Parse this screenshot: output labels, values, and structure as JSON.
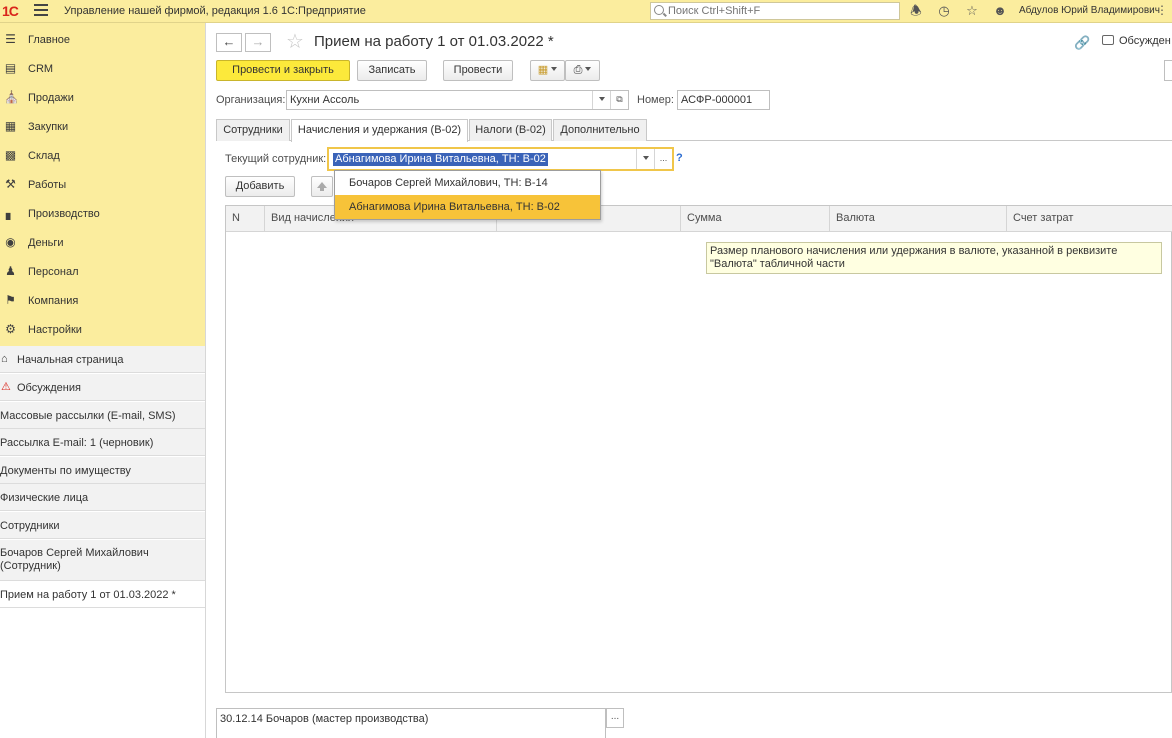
{
  "topbar": {
    "logo": "1С",
    "app_title": "Управление нашей фирмой, редакция 1.6 1С:Предприятие",
    "search_placeholder": "Поиск Ctrl+Shift+F",
    "user": "Абдулов Юрий Владимирович",
    "accent": "#fbed9e"
  },
  "sidebar": {
    "sections": [
      {
        "label": "Главное",
        "icon": "menu-lines-icon"
      },
      {
        "label": "CRM",
        "icon": "crm-card-icon"
      },
      {
        "label": "Продажи",
        "icon": "shop-icon"
      },
      {
        "label": "Закупки",
        "icon": "cart-icon"
      },
      {
        "label": "Склад",
        "icon": "warehouse-icon"
      },
      {
        "label": "Работы",
        "icon": "tools-icon"
      },
      {
        "label": "Производство",
        "icon": "factory-icon"
      },
      {
        "label": "Деньги",
        "icon": "money-icon"
      },
      {
        "label": "Персонал",
        "icon": "people-icon"
      },
      {
        "label": "Компания",
        "icon": "flag-icon"
      },
      {
        "label": "Настройки",
        "icon": "gear-icon"
      }
    ],
    "open_windows": [
      {
        "label": "Начальная страница",
        "icon": "home-icon"
      },
      {
        "label": "Обсуждения",
        "icon": "warning-icon"
      },
      {
        "label": "Массовые рассылки (E-mail, SMS)"
      },
      {
        "label": "Рассылка E-mail: 1  (черновик)"
      },
      {
        "label": "Документы по имуществу"
      },
      {
        "label": "Физические лица"
      },
      {
        "label": "Сотрудники"
      },
      {
        "label": "Бочаров Сергей Михайлович",
        "label2": "(Сотрудник)"
      },
      {
        "label": "Прием на работу 1 от 01.03.2022 *"
      }
    ]
  },
  "form": {
    "title": "Прием на работу 1 от 01.03.2022 *",
    "discussions": "Обсужден",
    "toolbar": {
      "post_close": "Провести и закрыть",
      "save": "Записать",
      "post": "Провести"
    },
    "organization_label": "Организация:",
    "organization_value": "Кухни Ассоль",
    "number_label": "Номер:",
    "number_value": "АСФР-000001",
    "tabs": [
      {
        "label": "Сотрудники"
      },
      {
        "label": "Начисления и удержания (В-02)"
      },
      {
        "label": "Налоги (В-02)"
      },
      {
        "label": "Дополнительно"
      }
    ],
    "current_employee_label": "Текущий сотрудник:",
    "current_employee_value": "Абнагимова Ирина Витальевна, ТН: В-02",
    "add_button": "Добавить",
    "help_mark": "?",
    "dropdown": [
      {
        "label": "Бочаров Сергей Михайлович, ТН: В-14"
      },
      {
        "label": "Абнагимова Ирина Витальевна, ТН: В-02"
      }
    ],
    "columns": [
      "N",
      "Вид начисления",
      "",
      "Сумма",
      "Валюта",
      "Счет затрат"
    ],
    "tooltip": "Размер планового начисления или удержания в валюте, указанной в реквизите \"Валюта\" табличной части",
    "bottom_field": "30.12.14 Бочаров (мастер производства)",
    "dots": "..."
  }
}
